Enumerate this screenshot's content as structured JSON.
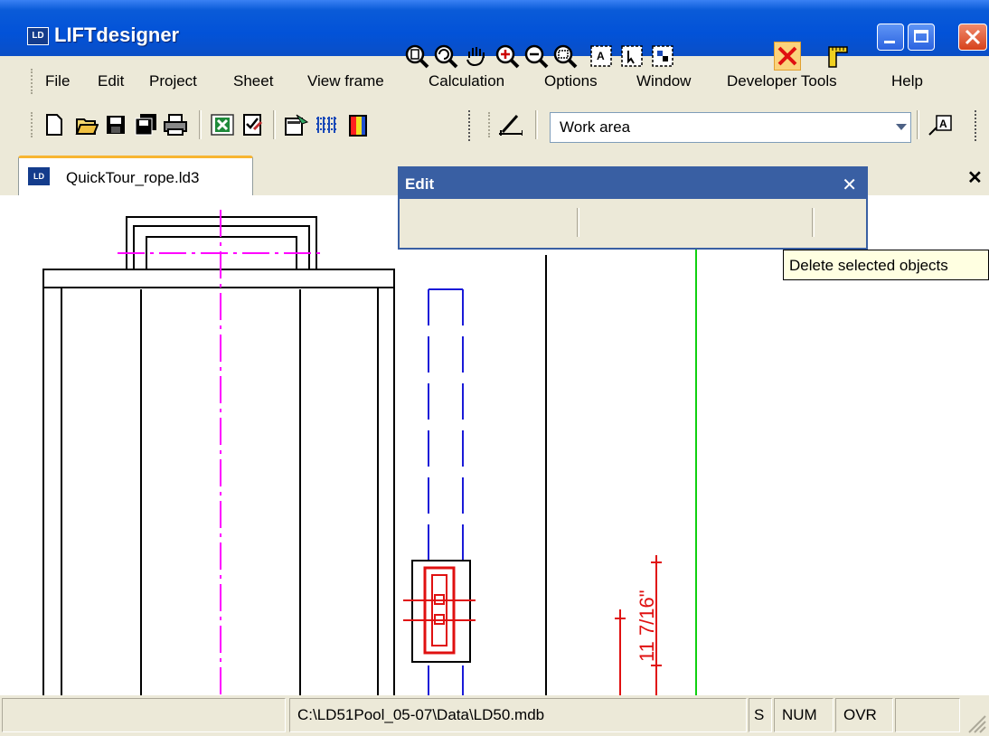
{
  "window": {
    "title": "LIFTdesigner",
    "app_icon": "LD"
  },
  "menu": [
    "File",
    "Edit",
    "Project",
    "Sheet",
    "View frame",
    "Calculation",
    "Options",
    "Window",
    "Developer Tools",
    "Help"
  ],
  "toolbar": {
    "icons": [
      "new-icon",
      "open-icon",
      "save-icon",
      "save-all-icon",
      "print-icon",
      "excel-icon",
      "checklist-icon",
      "properties-icon",
      "grid-icon",
      "color-icon",
      "dimension-icon",
      "text-icon"
    ],
    "workarea_value": "Work area"
  },
  "tab": {
    "label": "QuickTour_rope.ld3",
    "icon": "LD"
  },
  "edit_panel": {
    "title": "Edit",
    "buttons": [
      "zoom-page-icon",
      "zoom-previous-icon",
      "pan-icon",
      "zoom-in-icon",
      "zoom-out-icon",
      "zoom-window-icon",
      "select-text-icon",
      "select-icon",
      "select-block-icon",
      "delete-icon",
      "measure-icon"
    ]
  },
  "tooltip": "Delete selected objects",
  "drawing": {
    "dimension_label": "11 7/16\""
  },
  "status": {
    "path": "C:\\LD51Pool_05-07\\Data\\LD50.mdb",
    "s": "S",
    "num": "NUM",
    "ovr": "OVR"
  }
}
